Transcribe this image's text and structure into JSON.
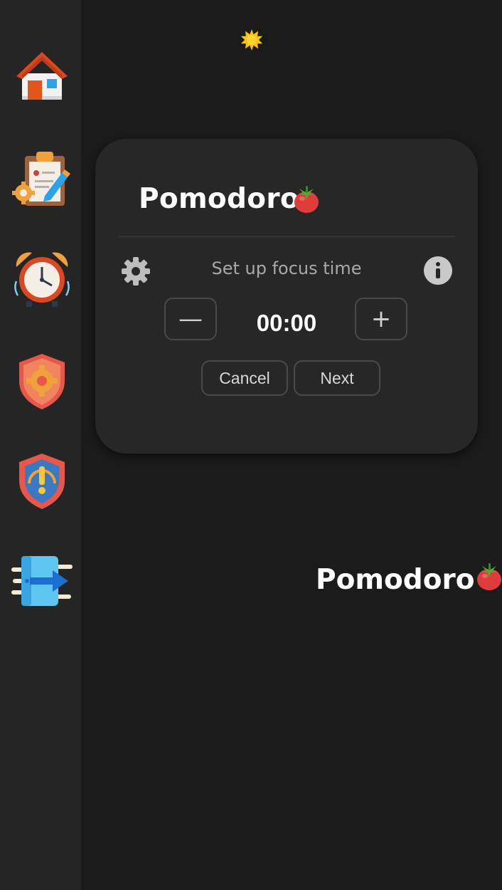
{
  "sidebar": {
    "items": [
      {
        "icon": "home-icon"
      },
      {
        "icon": "tasks-clipboard-icon"
      },
      {
        "icon": "alarm-clock-icon"
      },
      {
        "icon": "settings-shield-icon"
      },
      {
        "icon": "warning-shield-icon"
      },
      {
        "icon": "logout-icon"
      }
    ]
  },
  "theme_toggle": {
    "icon": "sun-icon"
  },
  "card": {
    "title": "Pomodoro",
    "title_icon": "tomato-icon",
    "settings_icon": "gear-icon",
    "setup_label": "Set up focus time",
    "info_icon": "info-icon",
    "decrement_label": "—",
    "increment_label": "+",
    "time": "00:00",
    "cancel_label": "Cancel",
    "next_label": "Next"
  },
  "footer_title": "Pomodoro",
  "colors": {
    "background": "#1b1b1b",
    "sidebar": "#252525",
    "card": "#272727",
    "border": "#4a4a4a",
    "muted_text": "#a9a9a9"
  }
}
